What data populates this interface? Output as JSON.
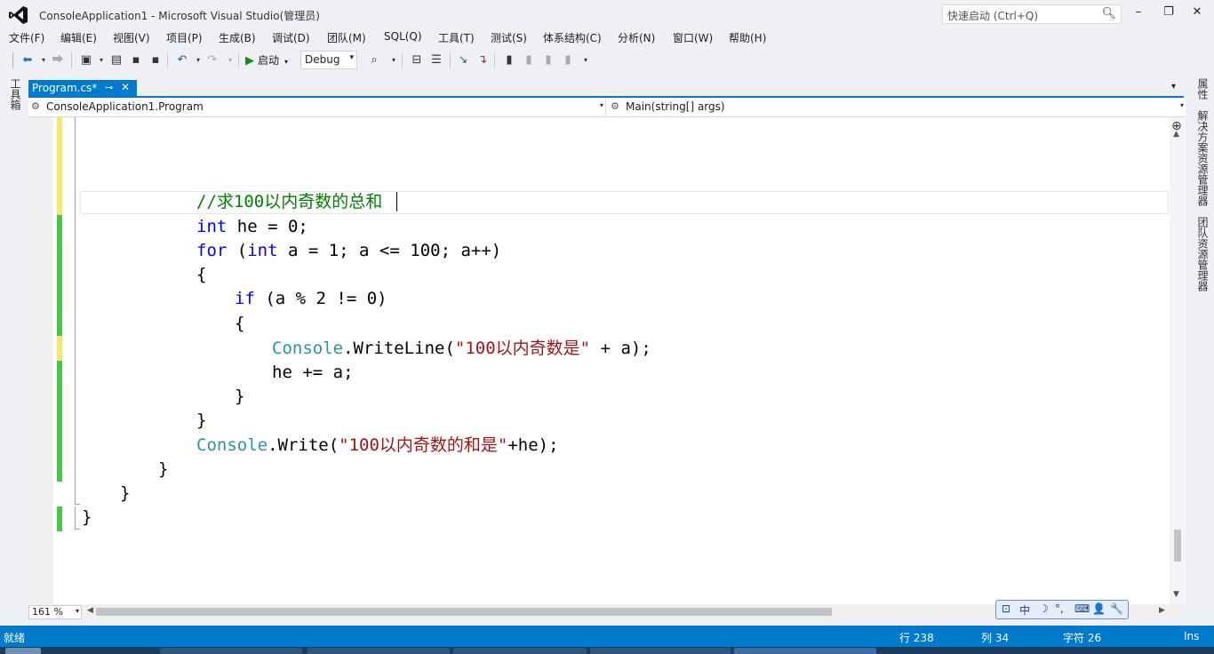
{
  "window": {
    "title": "ConsoleApplication1 - Microsoft Visual Studio(管理员)",
    "quick_launch_placeholder": "快速启动 (Ctrl+Q)",
    "minimize": "–",
    "maximize": "❐",
    "close": "✕"
  },
  "menu": [
    "文件(F)",
    "编辑(E)",
    "视图(V)",
    "项目(P)",
    "生成(B)",
    "调试(D)",
    "团队(M)",
    "SQL(Q)",
    "工具(T)",
    "测试(S)",
    "体系结构(C)",
    "分析(N)",
    "窗口(W)",
    "帮助(H)"
  ],
  "toolbar": {
    "start_label": "启动",
    "config_value": "Debug"
  },
  "left_panel": {
    "toolbox_label": "工具箱"
  },
  "tab": {
    "name": "Program.cs*",
    "pin": "⊸",
    "close": "✕"
  },
  "nav": {
    "class_value": "ConsoleApplication1.Program",
    "member_value": "Main(string[] args)"
  },
  "code": {
    "line1_comment": "//求100以内奇数的总和",
    "line2_kw": "int",
    "line2_rest": " he = 0;",
    "line3_kw1": "for",
    "line3_paren": " (",
    "line3_kw2": "int",
    "line3_rest": " a = 1; a <= 100; a++)",
    "line4": "{",
    "line5_kw": "if",
    "line5_rest": " (a % 2 != 0)",
    "line6": "{",
    "line7_type": "Console",
    "line7_method": ".WriteLine(",
    "line7_str": "\"100以内奇数是\"",
    "line7_rest": " + a);",
    "line8": "he += a;",
    "line9": "}",
    "line10": "}",
    "line11_type": "Console",
    "line11_method": ".Write(",
    "line11_str": "\"100以内奇数的和是\"",
    "line11_rest": "+he);",
    "line12": "}",
    "line13": "}",
    "line14": "}"
  },
  "editor_footer": {
    "zoom": "161 %"
  },
  "ime": [
    "中",
    "☽",
    "°,",
    "⌨",
    "👤",
    "🔧"
  ],
  "right_panel": {
    "properties_label": "属性",
    "solution_explorer_label": "解决方案资源管理器",
    "team_explorer_label": "团队资源管理器"
  },
  "status": {
    "ready": "就绪",
    "line": "行 238",
    "col": "列 34",
    "char": "字符 26",
    "mode": "Ins"
  },
  "colors": {
    "accent": "#007acc",
    "change_saved": "#46c746",
    "change_unsaved": "#f3e86a"
  }
}
